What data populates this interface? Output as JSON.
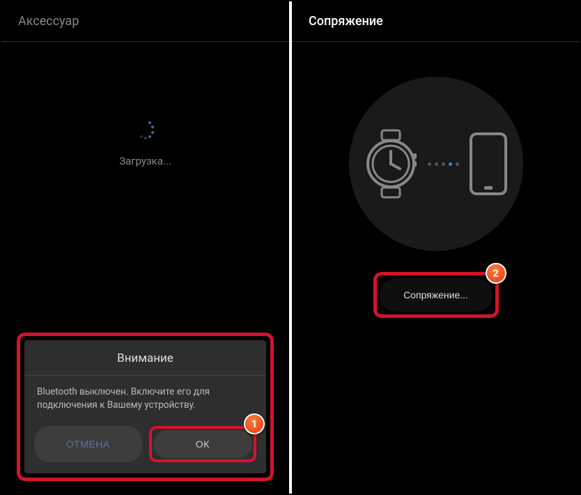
{
  "left": {
    "title": "Аксессуар",
    "loading_text": "Загрузка..."
  },
  "dialog": {
    "title": "Внимание",
    "message": "Bluetooth выключен. Включите его для подключения к Вашему устройству.",
    "cancel": "ОТМЕНА",
    "ok": "ОК"
  },
  "right": {
    "title": "Сопряжение",
    "pair_button": "Сопряжение..."
  },
  "badges": {
    "one": "1",
    "two": "2"
  }
}
